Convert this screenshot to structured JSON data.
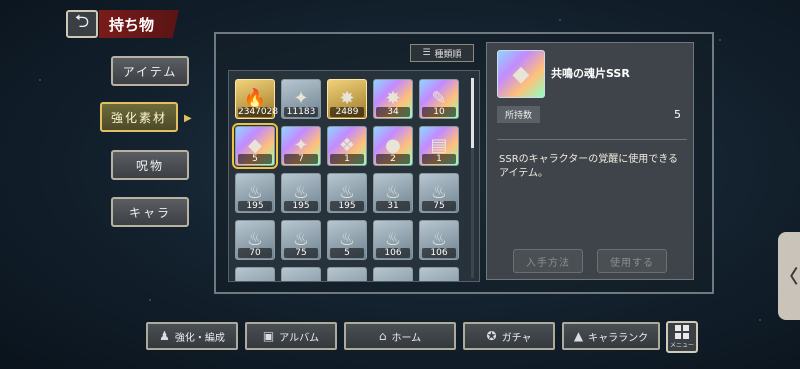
{
  "header": {
    "back_icon": "back-arrow-icon",
    "title": "持ち物"
  },
  "side_nav": [
    {
      "label": "アイテム",
      "active": false
    },
    {
      "label": "強化素材",
      "active": true
    },
    {
      "label": "呪物",
      "active": false
    },
    {
      "label": "キャラ",
      "active": false
    }
  ],
  "sort": {
    "label": "種類順",
    "icon": "sort-icon"
  },
  "items": [
    {
      "glyph": "🔥",
      "count": "2347028",
      "style": "gold-orb",
      "icon": "sun-orb-icon"
    },
    {
      "glyph": "✦",
      "count": "11183",
      "style": "crystal",
      "icon": "crystal-cluster-icon"
    },
    {
      "glyph": "✸",
      "count": "2489",
      "style": "gold",
      "icon": "gold-crystal-icon"
    },
    {
      "glyph": "✸",
      "count": "34",
      "style": "rainbow",
      "icon": "rainbow-crystal-icon"
    },
    {
      "glyph": "✎",
      "count": "10",
      "style": "rainbow",
      "icon": "rainbow-feather-icon"
    },
    {
      "glyph": "◆",
      "count": "5",
      "style": "rainbow",
      "icon": "soul-shard-icon",
      "selected": true
    },
    {
      "glyph": "✦",
      "count": "7",
      "style": "rainbow",
      "icon": "shard-cluster-icon"
    },
    {
      "glyph": "❖",
      "count": "1",
      "style": "rainbow",
      "icon": "rainbow-gem-icon"
    },
    {
      "glyph": "●",
      "count": "2",
      "style": "rainbow",
      "icon": "rainbow-orb-icon"
    },
    {
      "glyph": "▤",
      "count": "1",
      "style": "rainbow",
      "icon": "rainbow-card-icon"
    },
    {
      "glyph": "♨",
      "count": "195",
      "style": "normal",
      "icon": "red-flame-icon"
    },
    {
      "glyph": "♨",
      "count": "195",
      "style": "normal",
      "icon": "red-flame-icon"
    },
    {
      "glyph": "♨",
      "count": "195",
      "style": "normal",
      "icon": "red-flame-icon"
    },
    {
      "glyph": "♨",
      "count": "31",
      "style": "normal",
      "icon": "red-flame-icon"
    },
    {
      "glyph": "♨",
      "count": "75",
      "style": "normal",
      "icon": "blue-flame-icon"
    },
    {
      "glyph": "♨",
      "count": "70",
      "style": "normal",
      "icon": "blue-flame-icon"
    },
    {
      "glyph": "♨",
      "count": "75",
      "style": "normal",
      "icon": "blue-flame-icon"
    },
    {
      "glyph": "♨",
      "count": "5",
      "style": "normal",
      "icon": "blue-flame-icon"
    },
    {
      "glyph": "♨",
      "count": "106",
      "style": "normal",
      "icon": "green-flame-icon"
    },
    {
      "glyph": "♨",
      "count": "106",
      "style": "normal",
      "icon": "green-flame-icon"
    },
    {
      "glyph": "",
      "count": "",
      "style": "normal",
      "icon": "partial-item-icon"
    },
    {
      "glyph": "",
      "count": "",
      "style": "normal",
      "icon": "partial-item-icon"
    },
    {
      "glyph": "",
      "count": "",
      "style": "normal",
      "icon": "partial-item-icon"
    },
    {
      "glyph": "",
      "count": "",
      "style": "normal",
      "icon": "partial-item-icon"
    },
    {
      "glyph": "",
      "count": "",
      "style": "normal",
      "icon": "partial-item-icon"
    }
  ],
  "detail": {
    "icon": "soul-shard-icon",
    "name": "共鳴の魂片SSR",
    "owned_label": "所持数",
    "owned_value": "5",
    "description": "SSRのキャラクターの覚醒に使用できるアイテム。",
    "acquire_label": "入手方法",
    "use_label": "使用する"
  },
  "bottom_nav": [
    {
      "label": "強化・編成",
      "icon": "team-icon"
    },
    {
      "label": "アルバム",
      "icon": "album-icon"
    },
    {
      "label": "ホーム",
      "icon": "home-icon"
    },
    {
      "label": "ガチャ",
      "icon": "gacha-icon"
    },
    {
      "label": "キャラランク",
      "icon": "rank-icon"
    }
  ],
  "menu": {
    "label": "メニュー",
    "icon": "grid-menu-icon"
  },
  "side_tab": {
    "glyph": "〈",
    "icon": "chevron-left-icon"
  }
}
